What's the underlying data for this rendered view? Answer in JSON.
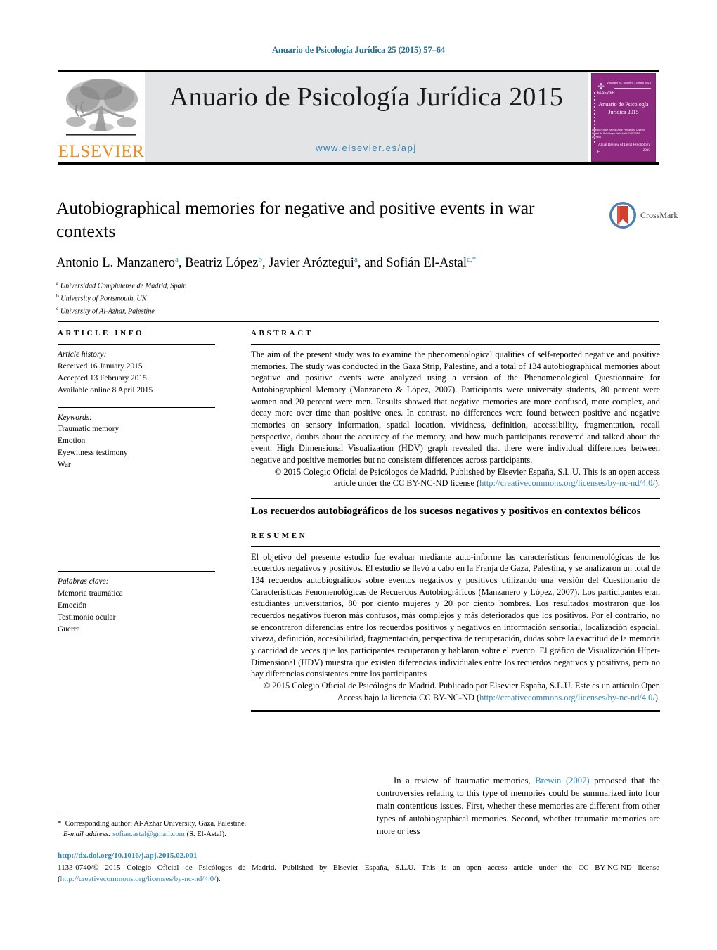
{
  "running_head": "Anuario de Psicología Jurídica 25 (2015) 57–64",
  "masthead": {
    "publisher_wordmark": "ELSEVIER",
    "publisher_color": "#F08C1E",
    "journal_title": "Anuario de Psicología Jurídica 2015",
    "journal_url": "www.elsevier.es/apj",
    "band_color": "#e3e4e6",
    "url_color": "#2e83b5",
    "cover": {
      "logo_text": "ELSEVIER",
      "issue_text": "Volumen 25, Número 1\nEnero 2015",
      "title": "Anuario de Psicología\nJurídica 2015",
      "mid_text": "Director/Editor\nRamón Arce Fernández\n\nColegio Oficial de Psicólogos de Madrid\nELSEVIER DOYMA",
      "footer": "Anual Review of Legal\nPsychology 2015",
      "background_color": "#8d2a7f"
    }
  },
  "article": {
    "title": "Autobiographical memories for negative and positive events in war contexts",
    "authors": [
      {
        "name": "Antonio L. Manzanero",
        "marks": "a",
        "sep": ",  "
      },
      {
        "name": "Beatriz López",
        "marks": "b",
        "sep": ",  "
      },
      {
        "name": "Javier Aróztegui",
        "marks": "a",
        "sep": ", and "
      },
      {
        "name": "Sofián El-Astal",
        "marks": "c,*",
        "sep": ""
      }
    ],
    "affiliations": [
      {
        "mark": "a",
        "text": "Universidad Complutense de Madrid, Spain"
      },
      {
        "mark": "b",
        "text": "University of Portsmouth, UK"
      },
      {
        "mark": "c",
        "text": "University of Al-Azhar, Palestine"
      }
    ],
    "crossmark_label": "CrossMark"
  },
  "article_info": {
    "heading": "ARTICLE INFO",
    "history_label": "Article history:",
    "history": [
      "Received 16 January 2015",
      "Accepted 13 February 2015",
      "Available online 8 April 2015"
    ],
    "keywords_label": "Keywords:",
    "keywords": [
      "Traumatic memory",
      "Emotion",
      "Eyewitness testimony",
      "War"
    ],
    "keywords_es_label": "Palabras clave:",
    "keywords_es": [
      "Memoria traumática",
      "Emoción",
      "Testimonio ocular",
      "Guerra"
    ]
  },
  "abstract": {
    "heading": "ABSTRACT",
    "text": "The aim of the present study was to examine the phenomenological qualities of self-reported negative and positive memories. The study was conducted in the Gaza Strip, Palestine, and a total of 134 autobiographical memories about negative and positive events were analyzed using a version of the Phenomenological Questionnaire for Autobiographical Memory (Manzanero & López, 2007). Participants were university students, 80 percent were women and 20 percent were men. Results showed that negative memories are more confused, more complex, and decay more over time than positive ones. In contrast, no differences were found between positive and negative memories on sensory information, spatial location, vividness, definition, accessibility, fragmentation, recall perspective, doubts about the accuracy of the memory, and how much participants recovered and talked about the event. High Dimensional Visualization (HDV) graph revealed that there were individual differences between negative and positive memories but no consistent differences across participants.",
    "copyright_prefix": "© 2015 Colegio Oficial de Psicólogos de Madrid. Published by Elsevier España, S.L.U. This is an open access article under the CC BY-NC-ND license (",
    "copyright_link": "http://creativecommons.org/licenses/by-nc-nd/4.0/",
    "copyright_suffix": ")."
  },
  "resumen": {
    "title_es": "Los recuerdos autobiográficos de los sucesos negativos y positivos en contextos bélicos",
    "heading": "RESUMEN",
    "text": "El objetivo del presente estudio fue evaluar mediante auto-informe las características fenomenológicas de los recuerdos negativos y positivos. El estudio se llevó a cabo en la Franja de Gaza, Palestina, y se analizaron un total de 134 recuerdos autobiográficos sobre eventos negativos y positivos utilizando una versión del Cuestionario de Características Fenomenológicas de Recuerdos Autobiográficos (Manzanero y López, 2007). Los participantes eran estudiantes universitarios, 80 por ciento mujeres y 20 por ciento hombres. Los resultados mostraron que los recuerdos negativos fueron más confusos, más complejos y más deteriorados que los positivos. Por el contrario, no se encontraron diferencias entre los recuerdos positivos y negativos en información sensorial, localización espacial, viveza, definición, accesibilidad, fragmentación, perspectiva de recuperación, dudas sobre la exactitud de la memoria y cantidad de veces que los participantes recuperaron y hablaron sobre el evento. El gráfico de Visualización Híper-Dimensional (HDV) muestra que existen diferencias individuales entre los recuerdos negativos y positivos, pero no hay diferencias consistentes entre los participantes",
    "copyright_prefix": "© 2015 Colegio Oficial de Psicólogos de Madrid. Publicado por Elsevier España, S.L.U. Este es un artículo Open Access bajo la licencia CC BY-NC-ND (",
    "copyright_link": "http://creativecommons.org/licenses/by-nc-nd/4.0/",
    "copyright_suffix": ")."
  },
  "body": {
    "paragraph_prefix": "In a review of traumatic memories, ",
    "citation": "Brewin (2007)",
    "paragraph_suffix": " proposed that the controversies relating to this type of memories could be summarized into four main contentious issues. First, whether these memories are different from other types of autobiographical memories. Second, whether traumatic memories are more or less"
  },
  "footnotes": {
    "corresponding_marker": "*",
    "corresponding_text": "Corresponding author: Al-Azhar University, Gaza, Palestine.",
    "email_label": "E-mail address:",
    "email": "sofian.astal@gmail.com",
    "email_owner": "(S. El-Astal)."
  },
  "footer": {
    "doi": "http://dx.doi.org/10.1016/j.apj.2015.02.001",
    "issn_copyright": "1133-0740/© 2015 Colegio Oficial de Psicólogos de Madrid. Published by Elsevier España, S.L.U. This is an open access article under the CC BY-NC-ND license (",
    "license_link": "http://creativecommons.org/licenses/by-nc-nd/4.0/",
    "license_suffix": ").",
    "link_color": "#2e83b5"
  }
}
